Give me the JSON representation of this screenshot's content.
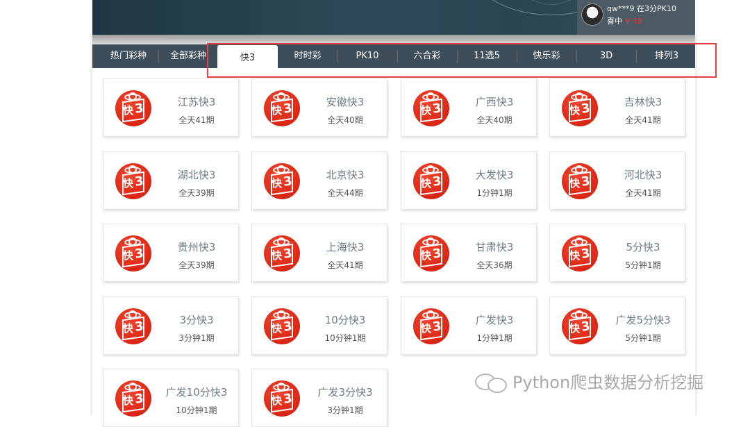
{
  "winner": {
    "line1": "qw***9 在3分PK10",
    "label": "喜中",
    "amount": "¥ 38"
  },
  "tabs": [
    {
      "label": "热门彩种"
    },
    {
      "label": "全部彩种"
    },
    {
      "label": "快3"
    },
    {
      "label": "时时彩"
    },
    {
      "label": "PK10"
    },
    {
      "label": "六合彩"
    },
    {
      "label": "11选5"
    },
    {
      "label": "快乐彩"
    },
    {
      "label": "3D"
    },
    {
      "label": "排列3"
    }
  ],
  "active_tab": "快3",
  "lotteries": [
    {
      "name": "江苏快3",
      "schedule": "全天41期"
    },
    {
      "name": "安徽快3",
      "schedule": "全天40期"
    },
    {
      "name": "广西快3",
      "schedule": "全天40期"
    },
    {
      "name": "吉林快3",
      "schedule": "全天41期"
    },
    {
      "name": "湖北快3",
      "schedule": "全天39期"
    },
    {
      "name": "北京快3",
      "schedule": "全天44期"
    },
    {
      "name": "大发快3",
      "schedule": "1分钟1期"
    },
    {
      "name": "河北快3",
      "schedule": "全天41期"
    },
    {
      "name": "贵州快3",
      "schedule": "全天39期"
    },
    {
      "name": "上海快3",
      "schedule": "全天41期"
    },
    {
      "name": "甘肃快3",
      "schedule": "全天36期"
    },
    {
      "name": "5分快3",
      "schedule": "5分钟1期"
    },
    {
      "name": "3分快3",
      "schedule": "3分钟1期"
    },
    {
      "name": "10分快3",
      "schedule": "10分钟1期"
    },
    {
      "name": "广发快3",
      "schedule": "1分钟1期"
    },
    {
      "name": "广发5分快3",
      "schedule": "5分钟1期"
    },
    {
      "name": "广发10分快3",
      "schedule": "10分钟1期"
    },
    {
      "name": "广发3分快3",
      "schedule": "3分钟1期"
    }
  ],
  "logo_text": {
    "kuai": "快",
    "three": "3"
  },
  "watermark": "Python爬虫数据分析挖掘",
  "colors": {
    "accent": "#e8322c",
    "tabbar": "#3d4d5a",
    "highlight": "#e84040"
  }
}
